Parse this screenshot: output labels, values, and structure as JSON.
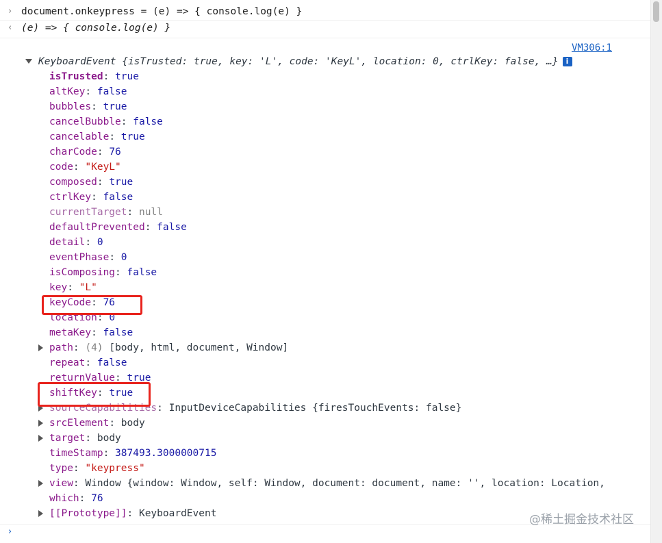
{
  "console": {
    "input_prompt": "›",
    "input_command": "document.onkeypress = (e) => { console.log(e) }",
    "result_prompt": "‹",
    "result_text": "(e) => { console.log(e) }",
    "source_link": "VM306:1",
    "next_prompt": "›"
  },
  "event": {
    "summary": "KeyboardEvent {isTrusted: true, key: 'L', code: 'KeyL', location: 0, ctrlKey: false, …}",
    "info_icon_glyph": "i",
    "properties": [
      {
        "key": "isTrusted",
        "value": "true"
      },
      {
        "key": "altKey",
        "value": "false"
      },
      {
        "key": "bubbles",
        "value": "true"
      },
      {
        "key": "cancelBubble",
        "value": "false"
      },
      {
        "key": "cancelable",
        "value": "true"
      },
      {
        "key": "charCode",
        "value": "76"
      },
      {
        "key": "code",
        "value": "\"KeyL\""
      },
      {
        "key": "composed",
        "value": "true"
      },
      {
        "key": "ctrlKey",
        "value": "false"
      },
      {
        "key": "currentTarget",
        "value": "null"
      },
      {
        "key": "defaultPrevented",
        "value": "false"
      },
      {
        "key": "detail",
        "value": "0"
      },
      {
        "key": "eventPhase",
        "value": "0"
      },
      {
        "key": "isComposing",
        "value": "false"
      },
      {
        "key": "key",
        "value": "\"L\""
      },
      {
        "key": "keyCode",
        "value": "76"
      },
      {
        "key": "location",
        "value": "0"
      },
      {
        "key": "metaKey",
        "value": "false"
      },
      {
        "key": "path",
        "value_prefix": "(4) ",
        "value": "[body, html, document, Window]"
      },
      {
        "key": "repeat",
        "value": "false"
      },
      {
        "key": "returnValue",
        "value": "true"
      },
      {
        "key": "shiftKey",
        "value": "true"
      },
      {
        "key": "sourceCapabilities",
        "value": "InputDeviceCapabilities {firesTouchEvents: false}"
      },
      {
        "key": "srcElement",
        "value": "body"
      },
      {
        "key": "target",
        "value": "body"
      },
      {
        "key": "timeStamp",
        "value": "387493.3000000715"
      },
      {
        "key": "type",
        "value": "\"keypress\""
      },
      {
        "key": "view",
        "value": "Window {window: Window, self: Window, document: document, name: '', location: Location,"
      },
      {
        "key": "which",
        "value": "76"
      },
      {
        "key": "[[Prototype]]",
        "value": "KeyboardEvent"
      }
    ]
  },
  "watermark": "@稀土掘金技术社区",
  "colors": {
    "highlight_box": "#e8231d",
    "property_key": "#8b1a8b",
    "boolean_number": "#1a1aa6",
    "string": "#c41a16",
    "link": "#1a62c4"
  }
}
